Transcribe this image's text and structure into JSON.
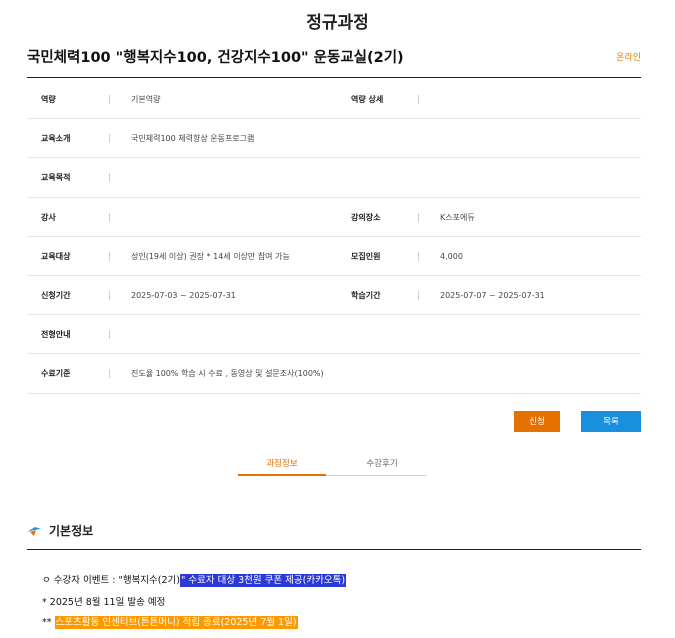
{
  "page": {
    "title": "정규과정"
  },
  "course": {
    "title": "국민체력100 \"행복지수100, 건강지수100\" 운동교실(2기)",
    "badge": "온라인"
  },
  "info": {
    "competency_label": "역량",
    "competency": "기본역량",
    "competency_detail_label": "역량 상세",
    "competency_detail": "",
    "intro_label": "교육소개",
    "intro": "국민체력100 체력향상 운동프로그램",
    "purpose_label": "교육목적",
    "purpose": "",
    "instructor_label": "강사",
    "instructor": "",
    "venue_label": "강의장소",
    "venue": "K스포에듀",
    "target_label": "교육대상",
    "target": "성인(19세 이상) 권장 * 14세 이상만 참여 가능",
    "capacity_label": "모집인원",
    "capacity": "4,000",
    "apply_period_label": "신청기간",
    "apply_period": "2025-07-03 ~ 2025-07-31",
    "study_period_label": "학습기간",
    "study_period": "2025-07-07 ~ 2025-07-31",
    "selection_label": "전형안내",
    "selection": "",
    "completion_label": "수료기준",
    "completion": "진도율 100% 학습 시 수료 , 동영상 및 설문조사(100%)"
  },
  "buttons": {
    "apply": "신청",
    "list": "목록"
  },
  "tabs": {
    "info": "과정정보",
    "review": "수강후기"
  },
  "section": {
    "title": "기본정보"
  },
  "notes": {
    "n1_prefix": "ㅇ 수강자 이벤트 : \"행복지수(2기)",
    "n1_highlight": "\" 수료자 대상 3천원 쿠폰 제공(카카오톡)",
    "n2": "* 2025년 8월 11일 발송 예정",
    "n3_prefix": "** ",
    "n3_highlight": "스포츠활동 인센티브(튼튼머니) 적립 종료(2025년 7월 1일)"
  },
  "colors": {
    "accent_orange": "#e57200",
    "accent_blue": "#1a8fde",
    "highlight_blue": "#2b3ad6",
    "highlight_orange": "#ff9900"
  }
}
